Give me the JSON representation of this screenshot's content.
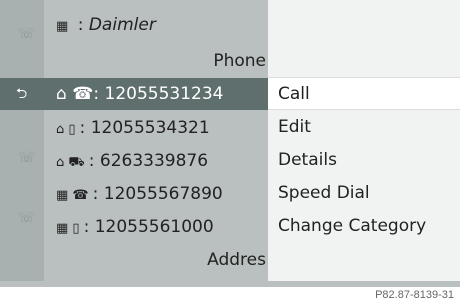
{
  "contact": {
    "name": "Daimler",
    "name_prefix": ":",
    "phone_header": "Phone",
    "address_header": "Addres"
  },
  "numbers": [
    {
      "category_icon": "home-icon",
      "type_icon": "phone-icon",
      "glyph": "⌂ ☎",
      "separator": ":",
      "number": "12055531234",
      "selected": true
    },
    {
      "category_icon": "home-icon",
      "type_icon": "mobile-icon",
      "glyph": "⌂ ▯",
      "separator": ":",
      "number": "12055534321",
      "selected": false
    },
    {
      "category_icon": "home-icon",
      "type_icon": "car-phone-icon",
      "glyph": "⌂ ⛟",
      "separator": ":",
      "number": "6263339876",
      "selected": false
    },
    {
      "category_icon": "business-icon",
      "type_icon": "phone-icon",
      "glyph": "▦ ☎",
      "separator": ":",
      "number": "12055567890",
      "selected": false
    },
    {
      "category_icon": "business-icon",
      "type_icon": "mobile-icon",
      "glyph": "▦ ▯",
      "separator": ":",
      "number": "12055561000",
      "selected": false
    }
  ],
  "menu": {
    "items": [
      "Call",
      "Edit",
      "Details",
      "Speed Dial",
      "Change Category"
    ],
    "selected_index": 0
  },
  "figure_code": "P82.87-8139-31",
  "colors": {
    "list_bg": "#b9c0bf",
    "selected_row": "#5f6f6e",
    "menu_bg": "#f1f2f2"
  }
}
